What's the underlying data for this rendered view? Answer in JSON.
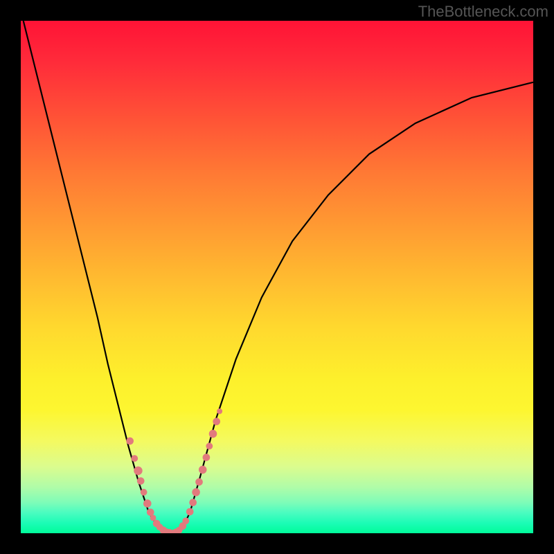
{
  "watermark": "TheBottleneck.com",
  "chart_data": {
    "type": "line",
    "title": "",
    "xlabel": "",
    "ylabel": "",
    "xlim": [
      0,
      100
    ],
    "ylim": [
      0,
      100
    ],
    "curve_points": [
      {
        "x": 0.5,
        "y": 100
      },
      {
        "x": 3,
        "y": 90
      },
      {
        "x": 6,
        "y": 78
      },
      {
        "x": 9,
        "y": 66
      },
      {
        "x": 12,
        "y": 54
      },
      {
        "x": 15,
        "y": 42
      },
      {
        "x": 17,
        "y": 33
      },
      {
        "x": 19,
        "y": 25
      },
      {
        "x": 21,
        "y": 17
      },
      {
        "x": 23,
        "y": 10
      },
      {
        "x": 25,
        "y": 4
      },
      {
        "x": 27,
        "y": 1
      },
      {
        "x": 28.5,
        "y": 0
      },
      {
        "x": 30,
        "y": 0
      },
      {
        "x": 31.5,
        "y": 1
      },
      {
        "x": 33,
        "y": 4
      },
      {
        "x": 35,
        "y": 11
      },
      {
        "x": 38,
        "y": 22
      },
      {
        "x": 42,
        "y": 34
      },
      {
        "x": 47,
        "y": 46
      },
      {
        "x": 53,
        "y": 57
      },
      {
        "x": 60,
        "y": 66
      },
      {
        "x": 68,
        "y": 74
      },
      {
        "x": 77,
        "y": 80
      },
      {
        "x": 88,
        "y": 85
      },
      {
        "x": 100,
        "y": 88
      }
    ],
    "markers_left": [
      {
        "x": 21.3,
        "y": 18.0,
        "r": 1.2
      },
      {
        "x": 22.2,
        "y": 14.6,
        "r": 1.1
      },
      {
        "x": 22.9,
        "y": 12.2,
        "r": 1.4
      },
      {
        "x": 23.4,
        "y": 10.2,
        "r": 1.2
      },
      {
        "x": 24.0,
        "y": 8.0,
        "r": 1.1
      },
      {
        "x": 24.7,
        "y": 5.8,
        "r": 1.3
      },
      {
        "x": 25.3,
        "y": 4.1,
        "r": 1.2
      },
      {
        "x": 25.8,
        "y": 3.0,
        "r": 1.0
      },
      {
        "x": 26.5,
        "y": 1.9,
        "r": 1.2
      },
      {
        "x": 27.1,
        "y": 1.2,
        "r": 1.1
      },
      {
        "x": 27.8,
        "y": 0.6,
        "r": 1.2
      },
      {
        "x": 28.4,
        "y": 0.3,
        "r": 1.1
      },
      {
        "x": 29.0,
        "y": 0.1,
        "r": 1.2
      },
      {
        "x": 29.7,
        "y": 0.0,
        "r": 1.1
      },
      {
        "x": 30.3,
        "y": 0.2,
        "r": 1.2
      },
      {
        "x": 30.9,
        "y": 0.6,
        "r": 1.1
      },
      {
        "x": 31.6,
        "y": 1.4,
        "r": 1.2
      },
      {
        "x": 32.2,
        "y": 2.4,
        "r": 1.1
      }
    ],
    "markers_right": [
      {
        "x": 33.0,
        "y": 4.2,
        "r": 1.2
      },
      {
        "x": 33.6,
        "y": 6.0,
        "r": 1.2
      },
      {
        "x": 34.2,
        "y": 8.0,
        "r": 1.3
      },
      {
        "x": 34.8,
        "y": 10.0,
        "r": 1.2
      },
      {
        "x": 35.5,
        "y": 12.4,
        "r": 1.3
      },
      {
        "x": 36.2,
        "y": 14.8,
        "r": 1.2
      },
      {
        "x": 36.8,
        "y": 17.0,
        "r": 1.1
      },
      {
        "x": 37.5,
        "y": 19.4,
        "r": 1.3
      },
      {
        "x": 38.2,
        "y": 21.8,
        "r": 1.2
      },
      {
        "x": 38.8,
        "y": 23.8,
        "r": 0.9
      }
    ],
    "color_scheme": {
      "top": "#ff1336",
      "mid_upper": "#ff9a32",
      "mid": "#ffd92e",
      "mid_lower": "#fdf630",
      "bottom": "#00fc9a",
      "curve": "#000000",
      "marker": "#e27a7d",
      "frame": "#000000"
    }
  }
}
